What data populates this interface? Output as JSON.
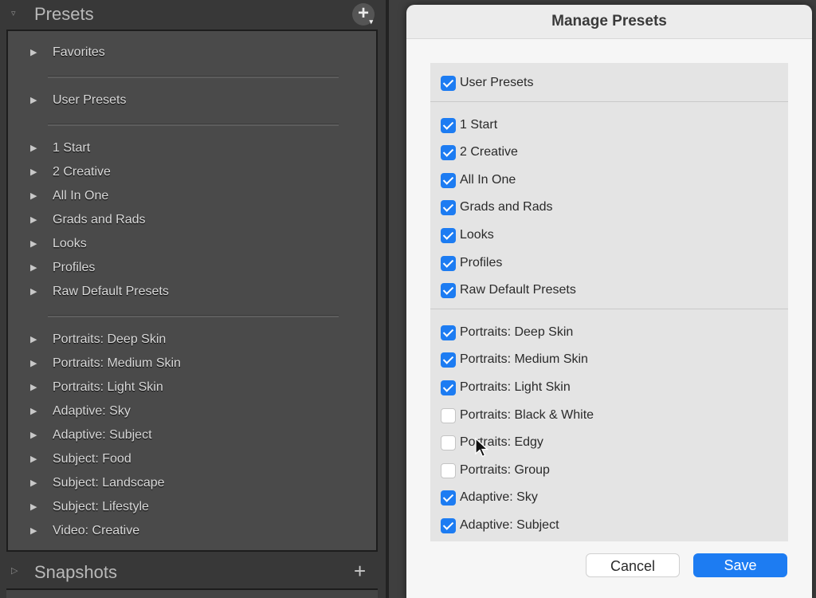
{
  "presets_panel": {
    "title": "Presets",
    "add_label": "+",
    "groups": [
      [
        "Favorites"
      ],
      [
        "User Presets"
      ],
      [
        "1 Start",
        "2 Creative",
        "All In One",
        "Grads and Rads",
        "Looks",
        "Profiles",
        "Raw Default Presets"
      ],
      [
        "Portraits: Deep Skin",
        "Portraits: Medium Skin",
        "Portraits: Light Skin",
        "Adaptive: Sky",
        "Adaptive: Subject",
        "Subject: Food",
        "Subject: Landscape",
        "Subject: Lifestyle",
        "Video: Creative"
      ]
    ]
  },
  "snapshots_panel": {
    "title": "Snapshots",
    "add_label": "+"
  },
  "dialog": {
    "title": "Manage Presets",
    "groups": [
      [
        {
          "label": "User Presets",
          "checked": true
        }
      ],
      [
        {
          "label": "1 Start",
          "checked": true
        },
        {
          "label": "2 Creative",
          "checked": true
        },
        {
          "label": "All In One",
          "checked": true
        },
        {
          "label": "Grads and Rads",
          "checked": true
        },
        {
          "label": "Looks",
          "checked": true
        },
        {
          "label": "Profiles",
          "checked": true
        },
        {
          "label": "Raw Default Presets",
          "checked": true
        }
      ],
      [
        {
          "label": "Portraits: Deep Skin",
          "checked": true
        },
        {
          "label": "Portraits: Medium Skin",
          "checked": true
        },
        {
          "label": "Portraits: Light Skin",
          "checked": true
        },
        {
          "label": "Portraits: Black & White",
          "checked": false
        },
        {
          "label": "Portraits: Edgy",
          "checked": false
        },
        {
          "label": "Portraits: Group",
          "checked": false
        },
        {
          "label": "Adaptive: Sky",
          "checked": true
        },
        {
          "label": "Adaptive: Subject",
          "checked": true
        }
      ]
    ],
    "cancel_label": "Cancel",
    "save_label": "Save"
  },
  "colors": {
    "accent": "#1d7cf2",
    "panel_bg": "#4a4a4a"
  },
  "icons": {
    "panel_toggle": "disclosure-triangle-icon",
    "row_expand": "expand-arrow-icon",
    "cursor": "mouse-pointer-icon"
  }
}
